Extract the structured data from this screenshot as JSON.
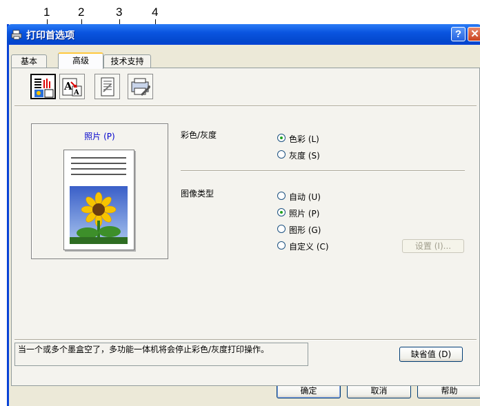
{
  "callouts": [
    "1",
    "2",
    "3",
    "4"
  ],
  "window": {
    "title": "打印首选项",
    "help_glyph": "?",
    "close_glyph": "✕"
  },
  "tabs": [
    {
      "label": "基本",
      "active": false
    },
    {
      "label": "高级",
      "active": true
    },
    {
      "label": "技术支持",
      "active": false
    }
  ],
  "toolbar": {
    "icons": [
      "color-quality-icon",
      "scaling-icon",
      "watermark-icon",
      "device-options-icon"
    ]
  },
  "preview": {
    "label": "照片 (P)"
  },
  "color_mode": {
    "label": "彩色/灰度",
    "options": [
      {
        "label": "色彩 (L)",
        "selected": true
      },
      {
        "label": "灰度 (S)",
        "selected": false
      }
    ]
  },
  "image_type": {
    "label": "图像类型",
    "options": [
      {
        "label": "自动 (U)",
        "selected": false
      },
      {
        "label": "照片 (P)",
        "selected": true
      },
      {
        "label": "图形 (G)",
        "selected": false
      },
      {
        "label": "自定义 (C)",
        "selected": false
      }
    ],
    "settings_button": "设置 (I)..."
  },
  "status_text": "当一个或多个墨盒空了，多功能一体机将会停止彩色/灰度打印操作。",
  "buttons": {
    "defaults": "缺省值 (D)",
    "ok": "确定",
    "cancel": "取消",
    "help": "帮助"
  },
  "colors": {
    "titlebar": "#0a55e0",
    "preview_label": "#0000cc",
    "radio_dot": "#21a121"
  }
}
